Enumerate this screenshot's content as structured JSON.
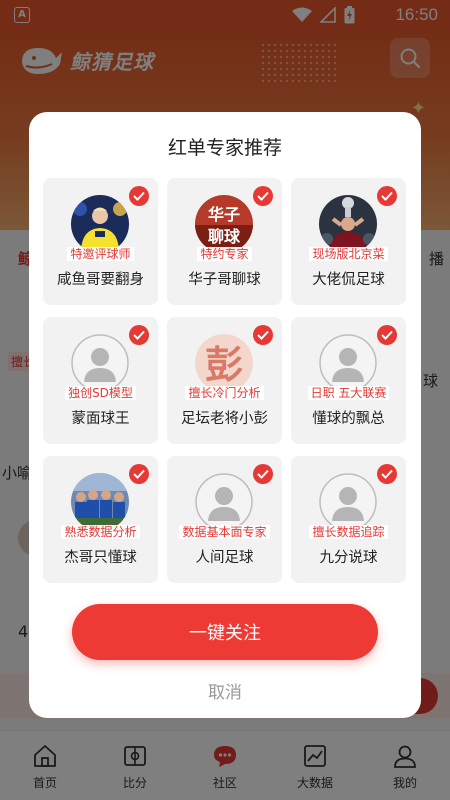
{
  "status_bar": {
    "time": "16:50",
    "app_badge": "A"
  },
  "app": {
    "logo_text": "鲸猜足球",
    "bg_tab_left": "鲸",
    "bg_tab_right": "播",
    "bg_text_left": "小喻",
    "bg_text_right": "球",
    "bg_number": "4",
    "bg_tag": "擅长"
  },
  "modal": {
    "title": "红单专家推荐",
    "follow_all_label": "一键关注",
    "cancel_label": "取消",
    "experts": [
      {
        "name": "咸鱼哥要翻身",
        "tag": "特邀评球师",
        "avatar": "photo-football-player",
        "selected": true
      },
      {
        "name": "华子哥聊球",
        "tag": "特约专家",
        "avatar": "text-logo-华子聊球",
        "selected": true
      },
      {
        "name": "大佬侃足球",
        "tag": "现场版北京菜",
        "avatar": "photo-trophy-lift",
        "selected": true
      },
      {
        "name": "蒙面球王",
        "tag": "独创SD模型",
        "avatar": "default-avatar",
        "selected": true
      },
      {
        "name": "足坛老将小彭",
        "tag": "擅长冷门分析",
        "avatar": "text-logo-彭",
        "selected": true
      },
      {
        "name": "懂球的飘总",
        "tag": "日职 五大联赛",
        "avatar": "default-avatar",
        "selected": true
      },
      {
        "name": "杰哥只懂球",
        "tag": "熟悉数据分析",
        "avatar": "photo-team",
        "selected": true
      },
      {
        "name": "人间足球",
        "tag": "数据基本面专家",
        "avatar": "default-avatar",
        "selected": true
      },
      {
        "name": "九分说球",
        "tag": "擅长数据追踪",
        "avatar": "default-avatar",
        "selected": true
      }
    ]
  },
  "bottom_nav": [
    {
      "label": "首页",
      "icon": "home-icon"
    },
    {
      "label": "比分",
      "icon": "scoreboard-icon"
    },
    {
      "label": "社区",
      "icon": "chat-bubble-icon",
      "active": true
    },
    {
      "label": "大数据",
      "icon": "chart-icon"
    },
    {
      "label": "我的",
      "icon": "user-icon"
    }
  ],
  "colors": {
    "accent": "#e53935",
    "header_orange": "#e9582e",
    "card_bg": "#f2f2f2"
  }
}
